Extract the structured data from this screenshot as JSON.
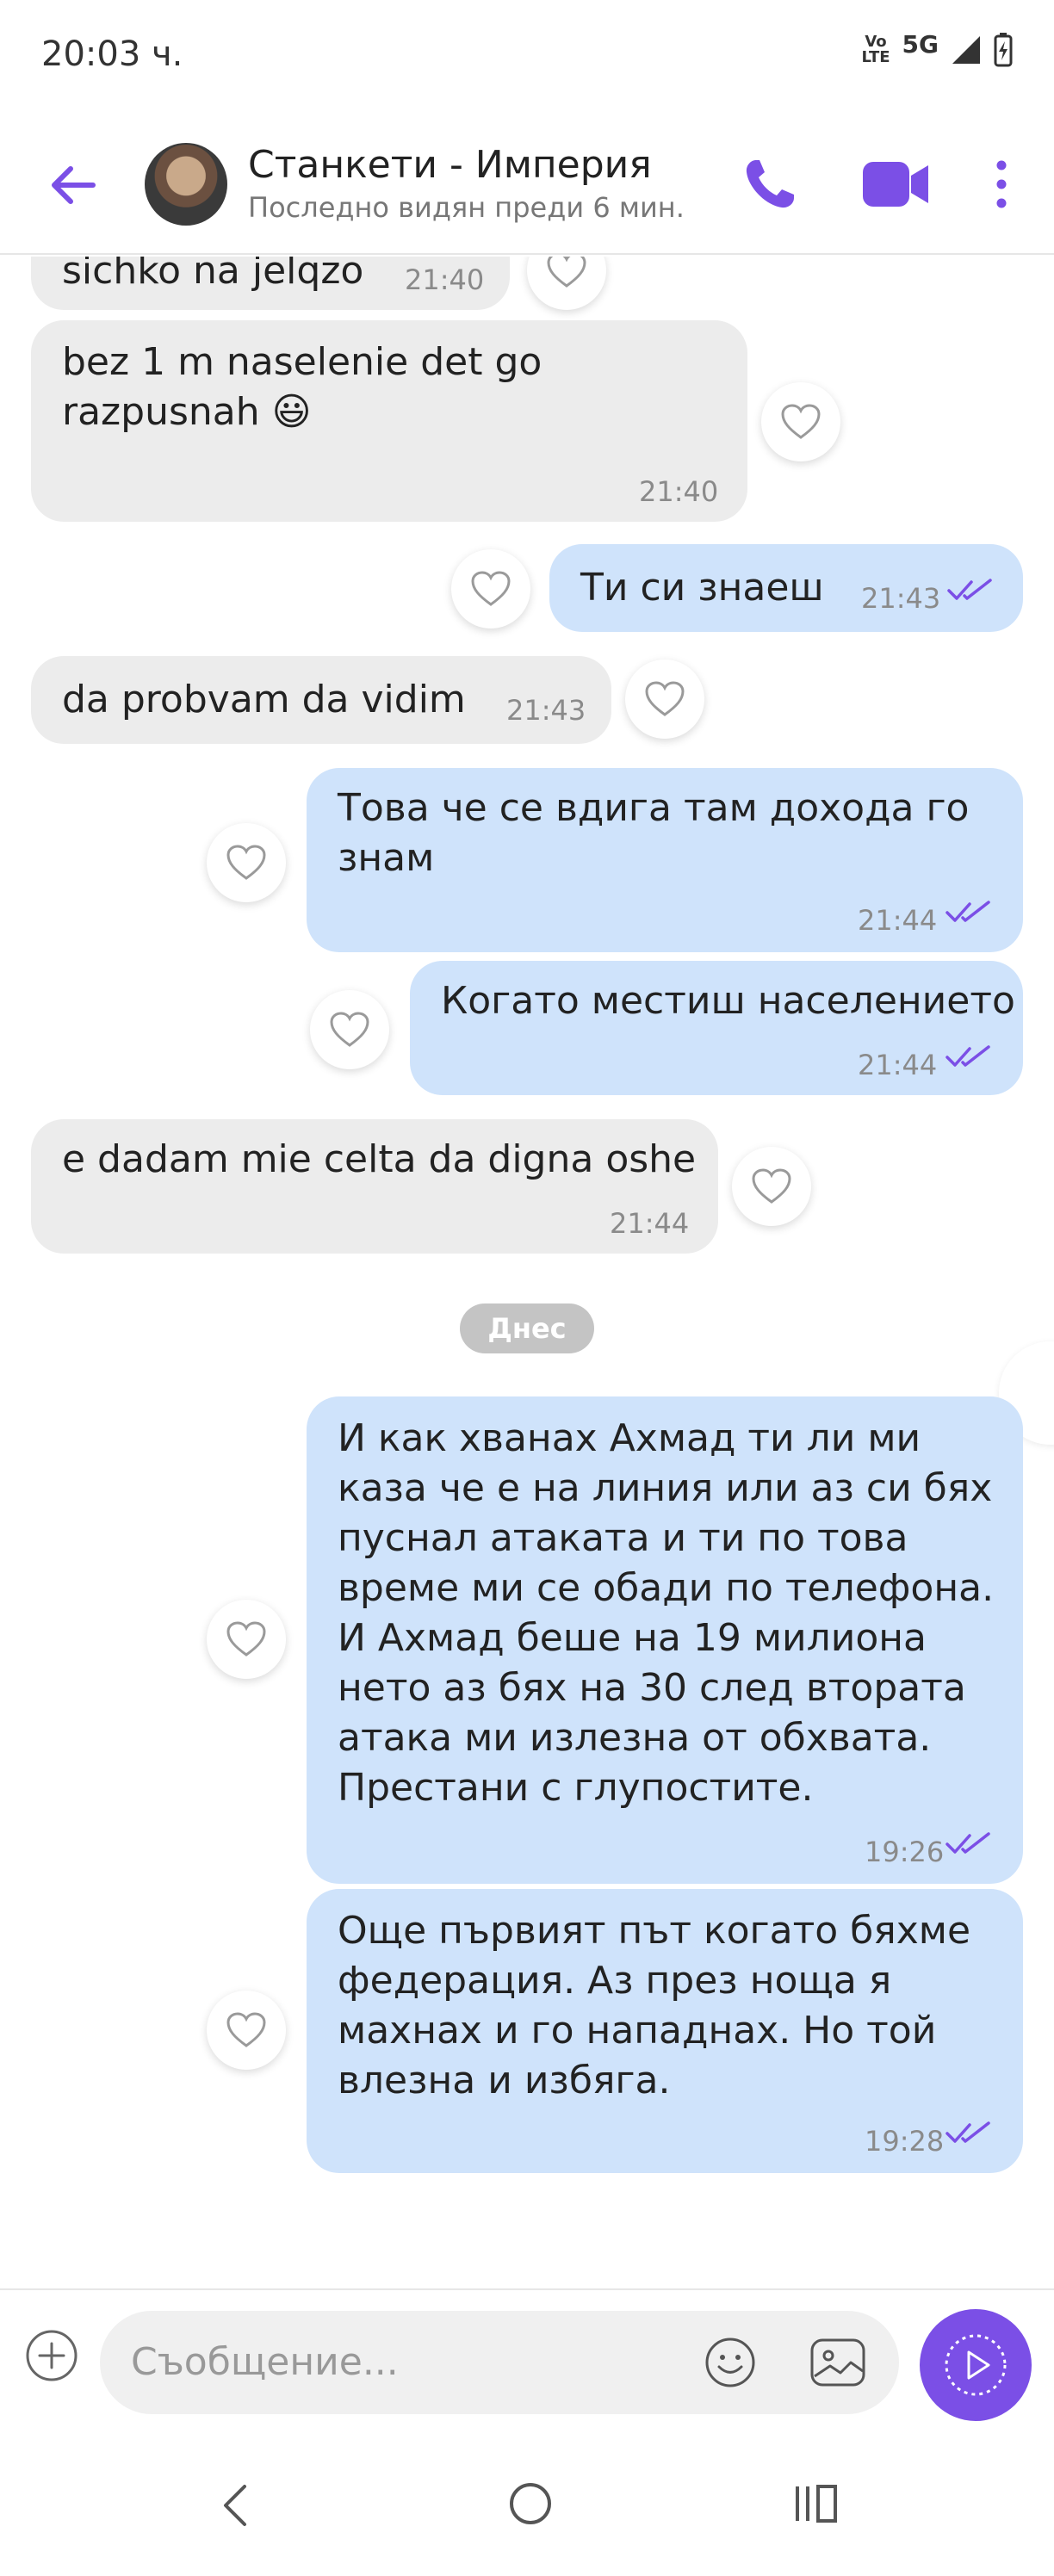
{
  "status_bar": {
    "time": "20:03 ч.",
    "volte": "Vo\nLTE",
    "network": "5G"
  },
  "header": {
    "contact_name": "Станкети - Империя",
    "last_seen": "Последно видян преди 6 мин."
  },
  "messages": [
    {
      "dir": "in",
      "text": "sichko na jelqzo",
      "time": "21:40"
    },
    {
      "dir": "in",
      "text": "bez 1 m naselenie det go razpusnah 😃",
      "time": "21:40"
    },
    {
      "dir": "out",
      "text": "Ти си знаеш",
      "time": "21:43",
      "status": "read"
    },
    {
      "dir": "in",
      "text": "da probvam da vidim",
      "time": "21:43"
    },
    {
      "dir": "out",
      "text": "Това че се вдига там дохода го знам",
      "time": "21:44",
      "status": "read"
    },
    {
      "dir": "out",
      "text": "Когато местиш населението",
      "time": "21:44",
      "status": "read"
    },
    {
      "dir": "in",
      "text": "e dadam mie celta da digna oshe",
      "time": "21:44"
    },
    {
      "dir": "out",
      "text": "И как хванах Ахмад ти ли ми каза че е на линия или аз си бях пуснал атаката и ти по това време ми се обади по телефона. И Ахмад беше на 19 милиона нето аз бях на 30 след втората атака ми излезна от обхвата. Престани с глупостите.",
      "time": "19:26",
      "status": "read"
    },
    {
      "dir": "out",
      "text": "Още първият път когато бяхме федерация. Аз през ноща я махнах и го нападнах. Но той влезна и избяга.",
      "time": "19:28",
      "status": "read"
    }
  ],
  "date_divider": "Днес",
  "composer": {
    "placeholder": "Съобщение..."
  },
  "colors": {
    "accent": "#7b4fe6",
    "incoming": "#ececec",
    "outgoing": "#cfe3fb"
  }
}
